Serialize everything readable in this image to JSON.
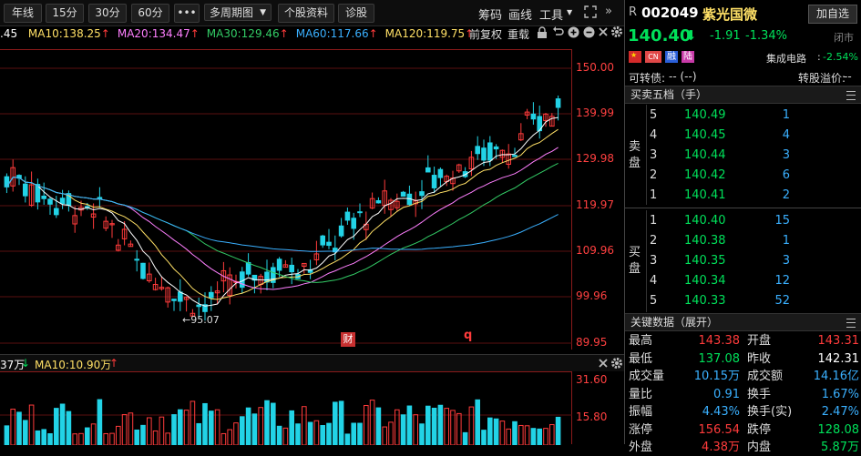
{
  "toolbar": {
    "periods": [
      "年线",
      "15分",
      "30分",
      "60分"
    ],
    "more": "•••",
    "multi_period": "多周期图",
    "stock_info": "个股资料",
    "diagnose": "诊股",
    "right_links": [
      "筹码",
      "画线",
      "工具"
    ]
  },
  "ma_bar": {
    "prefix": ".45",
    "items": [
      {
        "label": "MA10:138.25",
        "arrow": "↑",
        "color": "#ffe066"
      },
      {
        "label": "MA20:134.47",
        "arrow": "↑",
        "color": "#ff7fff"
      },
      {
        "label": "MA30:129.46",
        "arrow": "↑",
        "color": "#33cc66"
      },
      {
        "label": "MA60:117.66",
        "arrow": "↑",
        "color": "#3ab0ff"
      },
      {
        "label": "MA120:119.75",
        "arrow": "↑",
        "color": "#ffe066"
      }
    ],
    "adjust": "前复权",
    "fold": "重载"
  },
  "price_axis": [
    "150.00",
    "139.99",
    "129.98",
    "119.97",
    "109.96",
    "99.96",
    "89.95"
  ],
  "low_marker": "←95.07",
  "event_marks": [
    "财",
    "q"
  ],
  "vol_bar": {
    "prefix": "37万",
    "prefix_arrow": "↓",
    "ma10": "MA10:10.90万",
    "ma10_arrow": "↑"
  },
  "vol_axis": [
    "31.60",
    "15.80"
  ],
  "quote": {
    "r_badge": "R",
    "code": "002049",
    "name": "紫光国微",
    "add_watch": "加自选",
    "price": "140.40",
    "price_arrow": "⬇",
    "change": "-1.91",
    "change_pct": "-1.34%",
    "trade_status": "闭市",
    "tags": [
      "CN",
      "融",
      "陆"
    ],
    "sector": "集成电路",
    "sector_sep": ":",
    "sector_pct": "-2.54%",
    "convertible_label": "可转债:",
    "convertible_value": "-- (--)",
    "premium_label": "转股溢价:",
    "premium_value": "--"
  },
  "orderbook": {
    "title": "买卖五档（手）",
    "sell_label": "卖盘",
    "buy_label": "买盘",
    "sell": [
      {
        "level": "5",
        "price": "140.49",
        "vol": "1"
      },
      {
        "level": "4",
        "price": "140.45",
        "vol": "4"
      },
      {
        "level": "3",
        "price": "140.44",
        "vol": "3"
      },
      {
        "level": "2",
        "price": "140.42",
        "vol": "6"
      },
      {
        "level": "1",
        "price": "140.41",
        "vol": "2"
      }
    ],
    "buy": [
      {
        "level": "1",
        "price": "140.40",
        "vol": "15"
      },
      {
        "level": "2",
        "price": "140.38",
        "vol": "1"
      },
      {
        "level": "3",
        "price": "140.35",
        "vol": "3"
      },
      {
        "level": "4",
        "price": "140.34",
        "vol": "12"
      },
      {
        "level": "5",
        "price": "140.33",
        "vol": "52"
      }
    ]
  },
  "key_data": {
    "title": "关键数据（展开）",
    "rows": [
      {
        "l1": "最高",
        "v1": "143.38",
        "c1": "#ff3b3b",
        "l2": "开盘",
        "v2": "143.31",
        "c2": "#ff3b3b"
      },
      {
        "l1": "最低",
        "v1": "137.08",
        "c1": "#00e05a",
        "l2": "昨收",
        "v2": "142.31",
        "c2": "#ffffff"
      },
      {
        "l1": "成交量",
        "v1": "10.15万",
        "c1": "#3ab0ff",
        "l2": "成交额",
        "v2": "14.16亿",
        "c2": "#3ab0ff"
      },
      {
        "l1": "量比",
        "v1": "0.91",
        "c1": "#3ab0ff",
        "l2": "换手",
        "v2": "1.67%",
        "c2": "#3ab0ff"
      },
      {
        "l1": "振幅",
        "v1": "4.43%",
        "c1": "#3ab0ff",
        "l2": "换手(实)",
        "v2": "2.47%",
        "c2": "#3ab0ff"
      },
      {
        "l1": "涨停",
        "v1": "156.54",
        "c1": "#ff3b3b",
        "l2": "跌停",
        "v2": "128.08",
        "c2": "#00e05a"
      },
      {
        "l1": "外盘",
        "v1": "4.38万",
        "c1": "#ff3b3b",
        "l2": "内盘",
        "v2": "5.87万",
        "c2": "#00e05a"
      }
    ]
  }
}
